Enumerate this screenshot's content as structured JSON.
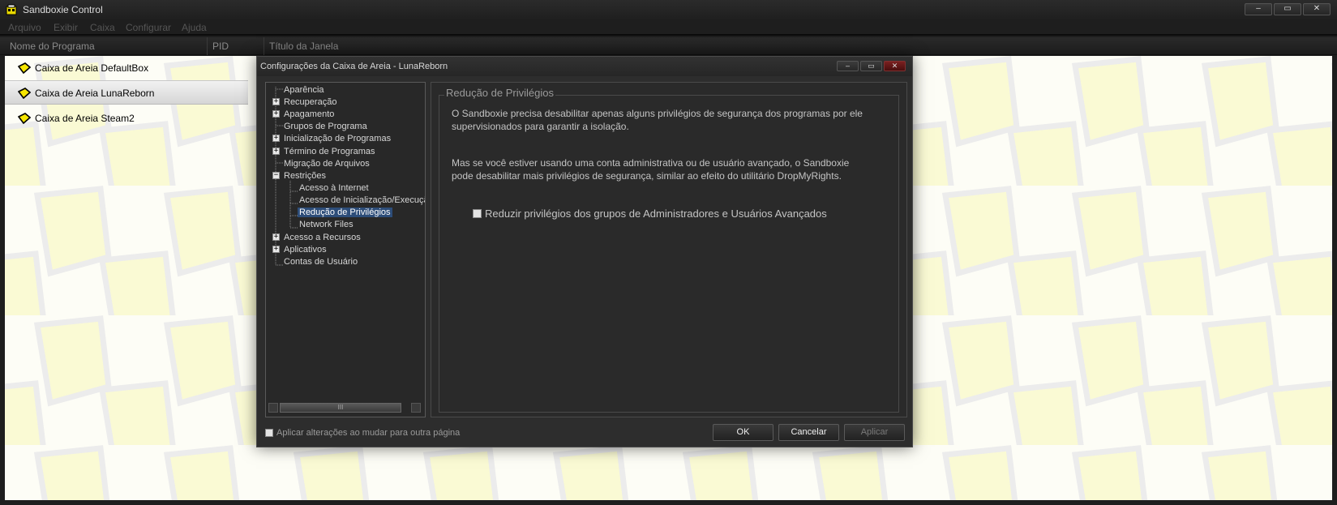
{
  "window": {
    "title": "Sandboxie Control",
    "controls": {
      "minimize": "–",
      "maximize": "▭",
      "close": "✕"
    }
  },
  "menu": [
    "Arquivo",
    "Exibir",
    "Caixa",
    "Configurar",
    "Ajuda"
  ],
  "columns": [
    "Nome do Programa",
    "PID",
    "Título da Janela"
  ],
  "sandboxes": [
    {
      "label": "Caixa de Areia DefaultBox",
      "selected": false
    },
    {
      "label": "Caixa de Areia LunaReborn",
      "selected": true
    },
    {
      "label": "Caixa de Areia Steam2",
      "selected": false
    }
  ],
  "dialog": {
    "title": "Configurações da Caixa de Areia - LunaReborn",
    "controls": {
      "minimize": "–",
      "maximize": "▭",
      "close": "✕"
    },
    "tree": [
      {
        "label": "Aparência",
        "level": 0,
        "expander": ""
      },
      {
        "label": "Recuperação",
        "level": 0,
        "expander": "+"
      },
      {
        "label": "Apagamento",
        "level": 0,
        "expander": "+"
      },
      {
        "label": "Grupos de Programa",
        "level": 0,
        "expander": ""
      },
      {
        "label": "Inicialização de Programas",
        "level": 0,
        "expander": "+"
      },
      {
        "label": "Término de Programas",
        "level": 0,
        "expander": "+"
      },
      {
        "label": "Migração de Arquivos",
        "level": 0,
        "expander": ""
      },
      {
        "label": "Restrições",
        "level": 0,
        "expander": "−"
      },
      {
        "label": "Acesso à Internet",
        "level": 1,
        "expander": ""
      },
      {
        "label": "Acesso de Inicialização/Execução",
        "level": 1,
        "expander": ""
      },
      {
        "label": "Redução de Privilégios",
        "level": 1,
        "expander": "",
        "selected": true
      },
      {
        "label": "Network Files",
        "level": 1,
        "expander": ""
      },
      {
        "label": "Acesso a Recursos",
        "level": 0,
        "expander": "+"
      },
      {
        "label": "Aplicativos",
        "level": 0,
        "expander": "+"
      },
      {
        "label": "Contas de Usuário",
        "level": 0,
        "expander": ""
      }
    ],
    "scroll_thumb_grip": "III",
    "page": {
      "group_title": "Redução de Privilégios",
      "paragraph1": "O Sandboxie precisa desabilitar apenas alguns privilégios de segurança dos programas por ele supervisionados para garantir a isolação.",
      "paragraph2": "Mas se você estiver usando uma conta administrativa ou de usuário avançado, o Sandboxie pode desabilitar mais privilégios de segurança, similar ao efeito do utilitário DropMyRights.",
      "checkbox_label": "Reduzir privilégios dos grupos de Administradores e Usuários Avançados",
      "checkbox_checked": false
    },
    "apply_on_switch_label": "Aplicar alterações ao mudar para outra página",
    "apply_on_switch_checked": false,
    "buttons": {
      "ok": "OK",
      "cancel": "Cancelar",
      "apply": "Aplicar"
    }
  },
  "colors": {
    "pattern_fill": "#fafad4",
    "pattern_stroke": "#ececec",
    "selection": "#2d4d79",
    "sandbox_icon": "#f6e600"
  }
}
